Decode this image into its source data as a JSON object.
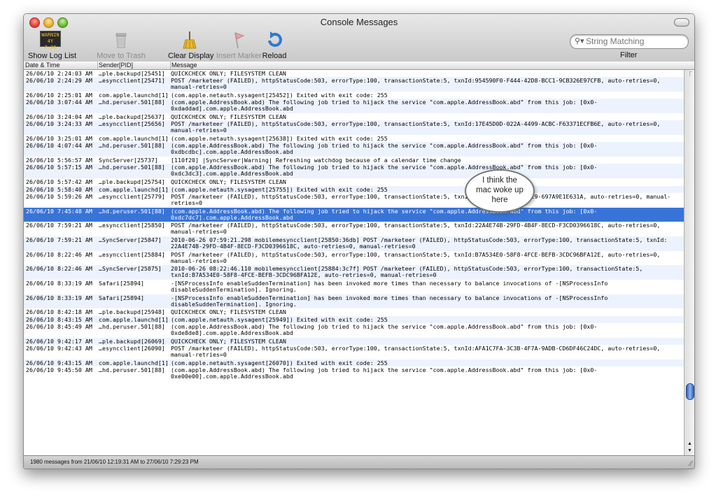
{
  "window": {
    "title": "Console Messages"
  },
  "toolbar": {
    "show_log_list": "Show Log List",
    "log_icon_text": "WARNIN 4Y 7:36",
    "move_to_trash": "Move to Trash",
    "clear_display": "Clear Display",
    "insert_marker": "Insert Marker",
    "reload": "Reload"
  },
  "search": {
    "placeholder": "String Matching",
    "filter_label": "Filter"
  },
  "columns": {
    "date": "Date & Time",
    "sender": "Sender[PID]",
    "message": "Message"
  },
  "rows": [
    {
      "date": "26/06/10 2:24:03 AM",
      "sender": "…ple.backupd[25451]",
      "message": "QUICKCHECK ONLY; FILESYSTEM CLEAN",
      "lines": 1
    },
    {
      "date": "26/06/10 2:24:29 AM",
      "sender": "…esyncclient[25471]",
      "message": "POST /marketeer (FAILED), httpStatusCode:503, errorType:100, transactionState:5, txnId:954590F0-F444-42D8-BCC1-9CB326E97CFB, auto-retries=0, manual-retries=0",
      "lines": 2
    },
    {
      "date": "26/06/10 2:25:01 AM",
      "sender": "com.apple.launchd[1]",
      "message": "(com.apple.netauth.sysagent[25452]) Exited with exit code: 255",
      "lines": 1
    },
    {
      "date": "26/06/10 3:07:44 AM",
      "sender": "…hd.peruser.501[88]",
      "message": "(com.apple.AddressBook.abd) The following job tried to hijack the service \"com.apple.AddressBook.abd\" from this job: [0x0-0xdaddad].com.apple.AddressBook.abd",
      "lines": 2
    },
    {
      "date": "26/06/10 3:24:04 AM",
      "sender": "…ple.backupd[25637]",
      "message": "QUICKCHECK ONLY; FILESYSTEM CLEAN",
      "lines": 1
    },
    {
      "date": "26/06/10 3:24:33 AM",
      "sender": "…esyncclient[25656]",
      "message": "POST /marketeer (FAILED), httpStatusCode:503, errorType:100, transactionState:5, txnId:17E45D0D-022A-4499-ACBC-F63371ECFB6E, auto-retries=0, manual-retries=0",
      "lines": 2
    },
    {
      "date": "26/06/10 3:25:01 AM",
      "sender": "com.apple.launchd[1]",
      "message": "(com.apple.netauth.sysagent[25638]) Exited with exit code: 255",
      "lines": 1
    },
    {
      "date": "26/06/10 4:07:44 AM",
      "sender": "…hd.peruser.501[88]",
      "message": "(com.apple.AddressBook.abd) The following job tried to hijack the service \"com.apple.AddressBook.abd\" from this job: [0x0-0xdbcdbc].com.apple.AddressBook.abd",
      "lines": 2
    },
    {
      "date": "26/06/10 5:56:57 AM",
      "sender": "SyncServer[25737]",
      "message": "[110f20] |SyncServer|Warning| Refreshing watchdog because of a calendar time change",
      "lines": 1
    },
    {
      "date": "26/06/10 5:57:15 AM",
      "sender": "…hd.peruser.501[88]",
      "message": "(com.apple.AddressBook.abd) The following job tried to hijack the service \"com.apple.AddressBook.abd\" from this job: [0x0-0xdc3dc3].com.apple.AddressBook.abd",
      "lines": 2
    },
    {
      "date": "26/06/10 5:57:42 AM",
      "sender": "…ple.backupd[25754]",
      "message": "QUICKCHECK ONLY; FILESYSTEM CLEAN",
      "lines": 1
    },
    {
      "date": "26/06/10 5:58:40 AM",
      "sender": "com.apple.launchd[1]",
      "message": "(com.apple.netauth.sysagent[25755]) Exited with exit code: 255",
      "lines": 1
    },
    {
      "date": "26/06/10 5:59:26 AM",
      "sender": "…esyncclient[25779]",
      "message": "POST /marketeer (FAILED), httpStatusCode:503, errorType:100, transactionState:5, txnId:06AF9E…3-4A6A-A529-697A9E1E631A, auto-retries=0, manual-retries=0",
      "lines": 2
    },
    {
      "date": "26/06/10 7:45:48 AM",
      "sender": "…hd.peruser.501[88]",
      "message": "(com.apple.AddressBook.abd) The following job tried to hijack the service \"com.apple.AddressBook.abd\" from this job: [0x0-0xdc7dc7].com.apple.AddressBook.abd",
      "lines": 2,
      "selected": true
    },
    {
      "date": "26/06/10 7:59:21 AM",
      "sender": "…esyncclient[25850]",
      "message": "POST /marketeer (FAILED), httpStatusCode:503, errorType:100, transactionState:5, txnId:22A4E74B-29FD-4B4F-8ECD-F3CD0396618C, auto-retries=0, manual-retries=0",
      "lines": 2
    },
    {
      "date": "26/06/10 7:59:21 AM",
      "sender": "…SyncServer[25847]",
      "message": "2010-06-26 07:59:21.298 mobilemesyncclient[25850:36db] POST /marketeer (FAILED), httpStatusCode:503, errorType:100, transactionState:5, txnId: 22A4E74B-29FD-4B4F-8ECD-F3CD0396618C, auto-retries=0, manual-retries=0",
      "lines": 2
    },
    {
      "date": "26/06/10 8:22:46 AM",
      "sender": "…esyncclient[25884]",
      "message": "POST /marketeer (FAILED), httpStatusCode:503, errorType:100, transactionState:5, txnId:B7A534E0-58F8-4FCE-BEFB-3CDC96BFA12E, auto-retries=0, manual-retries=0",
      "lines": 2
    },
    {
      "date": "26/06/10 8:22:46 AM",
      "sender": "…SyncServer[25875]",
      "message": "2010-06-26 08:22:46.110 mobilemesyncclient[25884:3c7f] POST /marketeer (FAILED), httpStatusCode:503, errorType:100, transactionState:5, txnId:B7A534E0-58F8-4FCE-BEFB-3CDC96BFA12E, auto-retries=0, manual-retries=0",
      "lines": 2
    },
    {
      "date": "26/06/10 8:33:19 AM",
      "sender": "Safari[25894]",
      "message": "-[NSProcessInfo enableSuddenTermination] has been invoked more times than necessary to balance invocations of -[NSProcessInfo disableSuddenTermination]. Ignoring.",
      "lines": 2
    },
    {
      "date": "26/06/10 8:33:19 AM",
      "sender": "Safari[25894]",
      "message": "-[NSProcessInfo enableSuddenTermination] has been invoked more times than necessary to balance invocations of -[NSProcessInfo disableSuddenTermination]. Ignoring.",
      "lines": 2
    },
    {
      "date": "26/06/10 8:42:18 AM",
      "sender": "…ple.backupd[25948]",
      "message": "QUICKCHECK ONLY; FILESYSTEM CLEAN",
      "lines": 1
    },
    {
      "date": "26/06/10 8:43:15 AM",
      "sender": "com.apple.launchd[1]",
      "message": "(com.apple.netauth.sysagent[25949]) Exited with exit code: 255",
      "lines": 1
    },
    {
      "date": "26/06/10 8:45:49 AM",
      "sender": "…hd.peruser.501[88]",
      "message": "(com.apple.AddressBook.abd) The following job tried to hijack the service \"com.apple.AddressBook.abd\" from this job: [0x0-0xde8de8].com.apple.AddressBook.abd",
      "lines": 2
    },
    {
      "date": "26/06/10 9:42:17 AM",
      "sender": "…ple.backupd[26069]",
      "message": "QUICKCHECK ONLY; FILESYSTEM CLEAN",
      "lines": 1
    },
    {
      "date": "26/06/10 9:42:43 AM",
      "sender": "…esyncclient[26090]",
      "message": "POST /marketeer (FAILED), httpStatusCode:503, errorType:100, transactionState:5, txnId:AFA1C7FA-3C3B-4F7A-9ADB-CD6DF46C24DC, auto-retries=0, manual-retries=0",
      "lines": 2
    },
    {
      "date": "26/06/10 9:43:15 AM",
      "sender": "com.apple.launchd[1]",
      "message": "(com.apple.netauth.sysagent[26070]) Exited with exit code: 255",
      "lines": 1
    },
    {
      "date": "26/06/10 9:45:50 AM",
      "sender": "…hd.peruser.501[88]",
      "message": "(com.apple.AddressBook.abd) The following job tried to hijack the service \"com.apple.AddressBook.abd\" from this job: [0x0-0xe00e00].com.apple.AddressBook.abd",
      "lines": 2
    }
  ],
  "status": "1980 messages from 21/06/10 12:19:31 AM to 27/06/10 7:29:23 PM",
  "annotation": "I think the mac woke up here",
  "icons": {
    "log": "warning-log-icon",
    "trash": "trash-icon",
    "clear": "broom-icon",
    "marker": "flag-icon",
    "reload": "reload-icon",
    "search": "magnifier-icon"
  }
}
